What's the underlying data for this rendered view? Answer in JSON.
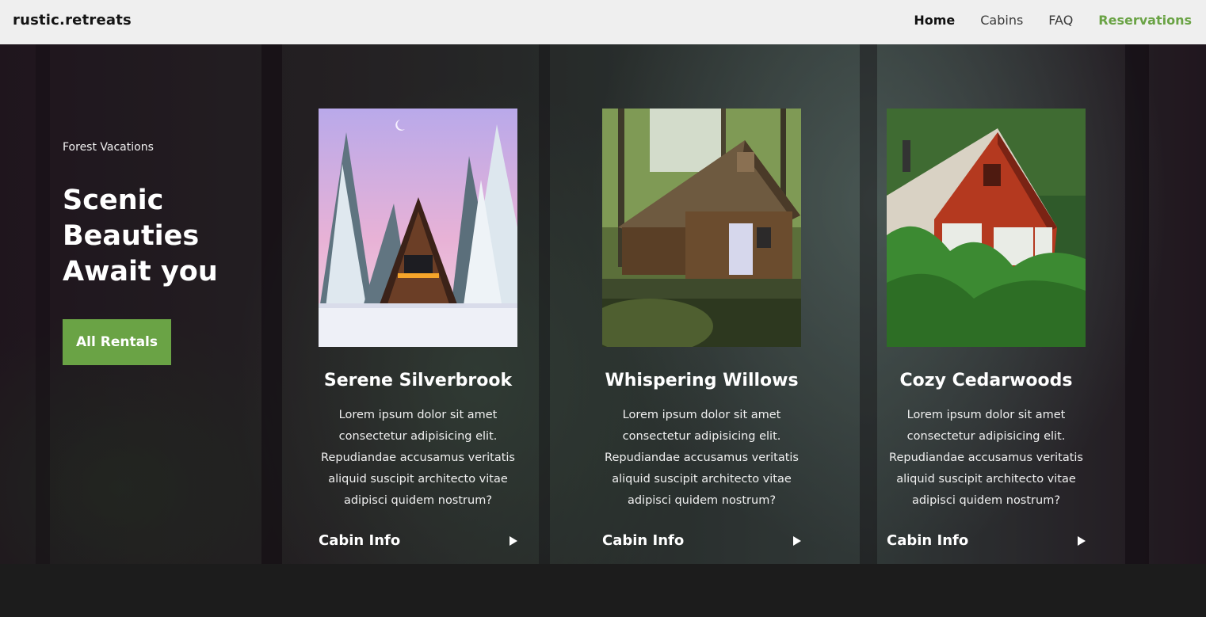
{
  "header": {
    "brand": "rustic.retreats",
    "nav": [
      {
        "label": "Home"
      },
      {
        "label": "Cabins"
      },
      {
        "label": "FAQ"
      },
      {
        "label": "Reservations"
      }
    ]
  },
  "hero": {
    "eyebrow": "Forest Vacations",
    "headline": "Scenic Beauties Await you",
    "cta": "All Rentals"
  },
  "cards": [
    {
      "title": "Serene Silverbrook",
      "description": "Lorem ipsum dolor sit amet consectetur adipisicing elit. Repudiandae accusamus veritatis aliquid suscipit architecto vitae adipisci quidem nostrum?",
      "link": "Cabin Info"
    },
    {
      "title": "Whispering Willows",
      "description": "Lorem ipsum dolor sit amet consectetur adipisicing elit. Repudiandae accusamus veritatis aliquid suscipit architecto vitae adipisci quidem nostrum?",
      "link": "Cabin Info"
    },
    {
      "title": "Cozy Cedarwoods",
      "description": "Lorem ipsum dolor sit amet consectetur adipisicing elit. Repudiandae accusamus veritatis aliquid suscipit architecto vitae adipisci quidem nostrum?",
      "link": "Cabin Info"
    }
  ],
  "colors": {
    "accent": "#6aa345",
    "header_bg": "#efefef",
    "footer_bg": "#1c1c1c"
  }
}
